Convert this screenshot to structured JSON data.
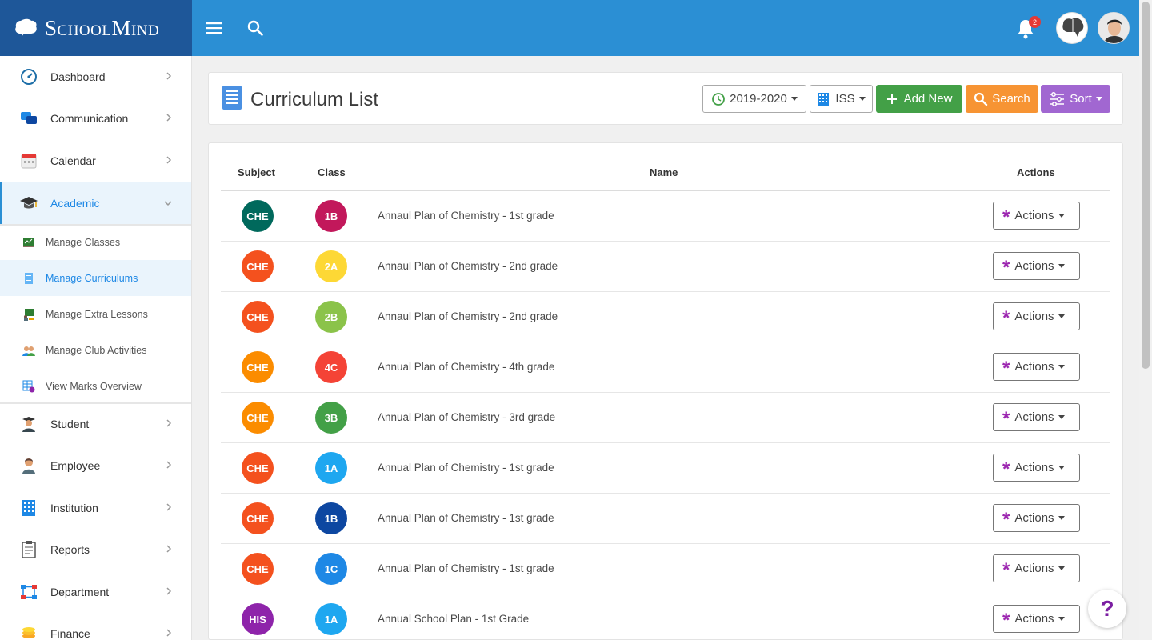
{
  "app": {
    "brand": "SchoolMind",
    "notification_count": "2"
  },
  "sidebar": {
    "items": [
      {
        "label": "Dashboard",
        "icon": "dashboard-icon"
      },
      {
        "label": "Communication",
        "icon": "chat-icon"
      },
      {
        "label": "Calendar",
        "icon": "calendar-icon"
      },
      {
        "label": "Academic",
        "icon": "graduation-cap-icon",
        "active": true
      },
      {
        "label": "Student",
        "icon": "student-icon"
      },
      {
        "label": "Employee",
        "icon": "employee-icon"
      },
      {
        "label": "Institution",
        "icon": "building-icon"
      },
      {
        "label": "Reports",
        "icon": "clipboard-icon"
      },
      {
        "label": "Department",
        "icon": "org-chart-icon"
      },
      {
        "label": "Finance",
        "icon": "coins-icon"
      }
    ],
    "sub_items": [
      {
        "label": "Manage Classes",
        "icon": "chalkboard-icon"
      },
      {
        "label": "Manage Curriculums",
        "icon": "document-icon",
        "active": true
      },
      {
        "label": "Manage Extra Lessons",
        "icon": "lesson-board-icon"
      },
      {
        "label": "Manage Club Activities",
        "icon": "group-icon"
      },
      {
        "label": "View Marks Overview",
        "icon": "marks-table-icon"
      }
    ]
  },
  "header": {
    "title": "Curriculum List",
    "year_select": "2019-2020",
    "school_select": "ISS",
    "add_new_label": "Add New",
    "search_label": "Search",
    "sort_label": "Sort"
  },
  "table": {
    "columns": [
      "Subject",
      "Class",
      "Name",
      "Actions"
    ],
    "action_label": "Actions",
    "rows": [
      {
        "subject": "CHE",
        "subject_color": "#00695c",
        "class": "1B",
        "class_color": "#c2185b",
        "name": "Annaul Plan of Chemistry - 1st grade"
      },
      {
        "subject": "CHE",
        "subject_color": "#f4511e",
        "class": "2A",
        "class_color": "#fdd835",
        "name": "Annaul Plan of Chemistry - 2nd grade"
      },
      {
        "subject": "CHE",
        "subject_color": "#f4511e",
        "class": "2B",
        "class_color": "#8bc34a",
        "name": "Annaul Plan of Chemistry - 2nd grade"
      },
      {
        "subject": "CHE",
        "subject_color": "#fb8c00",
        "class": "4C",
        "class_color": "#f44336",
        "name": "Annual Plan of Chemistry - 4th grade"
      },
      {
        "subject": "CHE",
        "subject_color": "#fb8c00",
        "class": "3B",
        "class_color": "#43a047",
        "name": "Annual Plan of Chemistry - 3rd grade"
      },
      {
        "subject": "CHE",
        "subject_color": "#f4511e",
        "class": "1A",
        "class_color": "#1ea7f0",
        "name": "Annual Plan of Chemistry - 1st grade"
      },
      {
        "subject": "CHE",
        "subject_color": "#f4511e",
        "class": "1B",
        "class_color": "#0d47a1",
        "name": "Annual Plan of Chemistry - 1st grade"
      },
      {
        "subject": "CHE",
        "subject_color": "#f4511e",
        "class": "1C",
        "class_color": "#1e88e5",
        "name": "Annual Plan of Chemistry - 1st grade"
      },
      {
        "subject": "HIS",
        "subject_color": "#8e24aa",
        "class": "1A",
        "class_color": "#1ea7f0",
        "name": "Annual School Plan - 1st Grade"
      }
    ]
  },
  "help_label": "?"
}
